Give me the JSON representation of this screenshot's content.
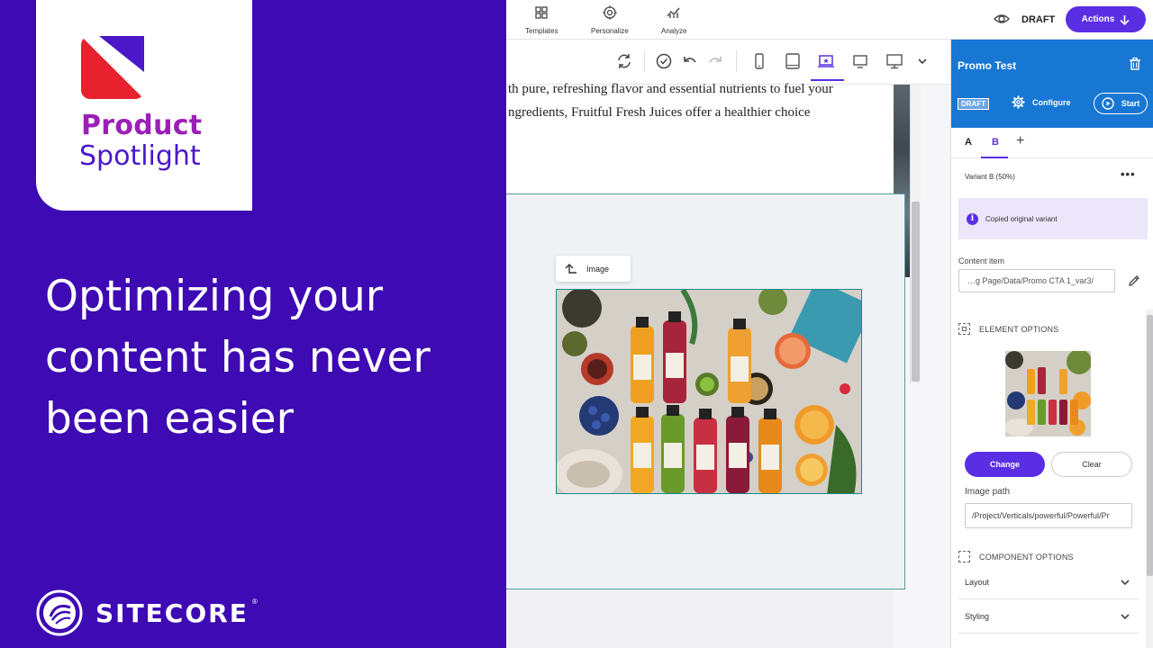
{
  "promo": {
    "badge_line1": "Product",
    "badge_line2": "Spotlight",
    "headline": "Optimizing your content has never been easier",
    "brand": "SITECORE",
    "brand_tm": "®"
  },
  "topbar": {
    "nav": [
      {
        "label": "Templates",
        "icon": "templates-icon"
      },
      {
        "label": "Personalize",
        "icon": "personalize-icon"
      },
      {
        "label": "Analyze",
        "icon": "analyze-icon"
      }
    ],
    "status": "DRAFT",
    "actions_label": "Actions"
  },
  "canvas": {
    "text_line1": "th pure, refreshing flavor and essential nutrients to fuel your",
    "text_line2": "ngredients, Fruitful Fresh Juices offer a healthier choice",
    "image_chip_label": "Image"
  },
  "panel": {
    "title": "Promo Test",
    "draft_badge": "DRAFT",
    "configure_label": "Configure",
    "start_label": "Start",
    "tabs": [
      "A",
      "B"
    ],
    "add_tab": "+",
    "variant_label": "Variant B  (50%)",
    "more": "•••",
    "info_icon": "i",
    "info_text": "Copied original variant",
    "content_item_label": "Content item",
    "content_item_value": "…g Page/Data/Promo CTA 1_var3/",
    "element_options": "ELEMENT OPTIONS",
    "change_label": "Change",
    "clear_label": "Clear",
    "image_path_label": "Image path",
    "image_path_value": "/Project/Verticals/powerful/Powerful/Pr",
    "component_options": "COMPONENT OPTIONS",
    "accordions": [
      "Layout",
      "Styling"
    ]
  },
  "colors": {
    "promo_bg": "#3d0ab3",
    "accent": "#5a2fe3",
    "panel_header": "#1877d3",
    "sitecore_red": "#e8212e"
  }
}
